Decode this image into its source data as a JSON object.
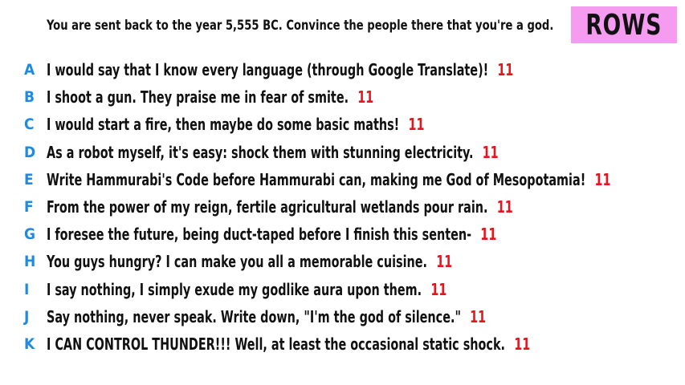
{
  "prompt": "You are sent back to the year 5,555 BC. Convince the people there that you're a god.",
  "badge": "ROWS",
  "accent_letter_color": "#1e8be0",
  "score_color": "#e8141c",
  "badge_color": "#f59cf0",
  "rows": [
    {
      "letter": "A",
      "text": "I would say that I know every language (through Google Translate)!",
      "score": "11"
    },
    {
      "letter": "B",
      "text": "I shoot a gun. They praise me in fear of smite.",
      "score": "11"
    },
    {
      "letter": "C",
      "text": "I would start a fire, then maybe do some basic maths!",
      "score": "11"
    },
    {
      "letter": "D",
      "text": "As a robot myself, it's easy: shock them with stunning electricity.",
      "score": "11"
    },
    {
      "letter": "E",
      "text": "Write Hammurabi's Code before Hammurabi can, making me God of Mesopotamia!",
      "score": "11"
    },
    {
      "letter": "F",
      "text": "From the power of my reign, fertile agricultural wetlands pour rain.",
      "score": "11"
    },
    {
      "letter": "G",
      "text": "I foresee the future, being duct-taped before I finish this senten-",
      "score": "11"
    },
    {
      "letter": "H",
      "text": "You guys hungry? I can make you all a memorable cuisine.",
      "score": "11"
    },
    {
      "letter": "I",
      "text": "I say nothing, I simply exude my godlike aura upon them.",
      "score": "11"
    },
    {
      "letter": "J",
      "text": "Say nothing, never speak. Write down, \"I'm the god of silence.\"",
      "score": "11"
    },
    {
      "letter": "K",
      "text": "I CAN CONTROL THUNDER!!! Well, at least the occasional static shock.",
      "score": "11"
    }
  ]
}
